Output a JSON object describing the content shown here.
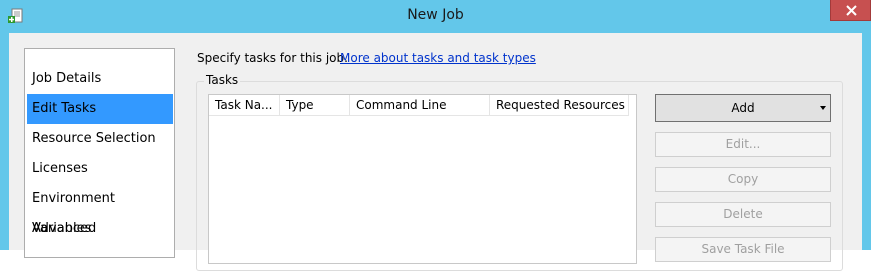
{
  "window": {
    "title": "New Job",
    "frame_color": "#63c7ea",
    "close_color": "#c75050"
  },
  "nav": {
    "items": [
      {
        "label": "Job Details",
        "selected": false
      },
      {
        "label": "Edit Tasks",
        "selected": true
      },
      {
        "label": "Resource Selection",
        "selected": false
      },
      {
        "label": "Licenses",
        "selected": false
      },
      {
        "label": "Environment Variables",
        "selected": false
      },
      {
        "label": "Advanced",
        "selected": false
      }
    ],
    "selected_color": "#3399ff"
  },
  "main": {
    "instruction": "Specify tasks for this job.",
    "link": "More about tasks and task types",
    "group_label": "Tasks",
    "columns": [
      "Task Na...",
      "Type",
      "Command Line",
      "Requested Resources"
    ],
    "buttons": {
      "add": "Add",
      "edit": "Edit...",
      "copy": "Copy",
      "delete": "Delete",
      "save_task_file": "Save Task File"
    }
  }
}
